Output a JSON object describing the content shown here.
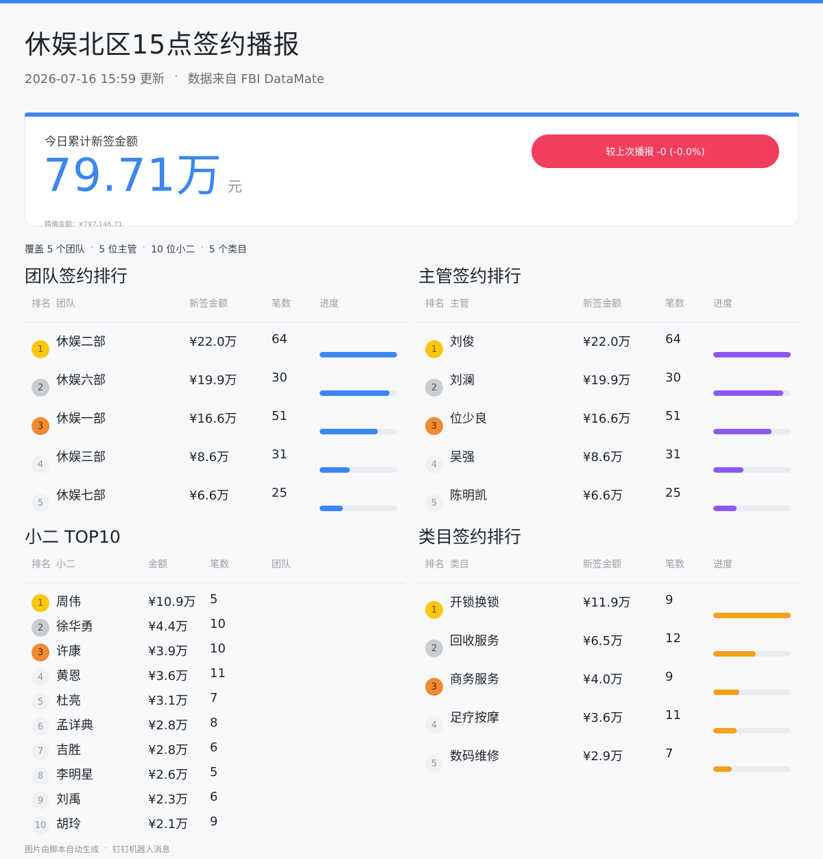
{
  "header": {
    "title": "休娱北区15点签约播报",
    "updated": "2026-07-16  15:59 更新",
    "source": "数据来自 FBI DataMate",
    "separator": "·"
  },
  "summary": {
    "label": "今日累计新签金额",
    "amount": "79.71万",
    "unit": "元",
    "exact": "精确金额：¥797,146.71",
    "compare": "较上次播报 -0 (-0.0%)"
  },
  "coverage": {
    "items": [
      "覆盖 5 个团队",
      "5 位主管",
      "10 位小二",
      "5 个类目"
    ],
    "separator": "·"
  },
  "colors": {
    "accent": "#3b86f0",
    "supervisor_bar": "#8c5af0",
    "category_bar": "#f5a01a",
    "alert": "#f23e5e"
  },
  "team_ranking": {
    "title": "团队签约排行",
    "headers": {
      "rank": "排名",
      "name": "团队",
      "amount": "新签金额",
      "count": "笔数",
      "progress": "进度"
    },
    "rows": [
      {
        "rank": "1",
        "name": "休娱二部",
        "amount": "¥22.0万",
        "count": "64",
        "progress": 1.0
      },
      {
        "rank": "2",
        "name": "休娱六部",
        "amount": "¥19.9万",
        "count": "30",
        "progress": 0.9
      },
      {
        "rank": "3",
        "name": "休娱一部",
        "amount": "¥16.6万",
        "count": "51",
        "progress": 0.75
      },
      {
        "rank": "4",
        "name": "休娱三部",
        "amount": "¥8.6万",
        "count": "31",
        "progress": 0.39
      },
      {
        "rank": "5",
        "name": "休娱七部",
        "amount": "¥6.6万",
        "count": "25",
        "progress": 0.3
      }
    ]
  },
  "supervisor_ranking": {
    "title": "主管签约排行",
    "headers": {
      "rank": "排名",
      "name": "主管",
      "amount": "新签金额",
      "count": "笔数",
      "progress": "进度"
    },
    "rows": [
      {
        "rank": "1",
        "name": "刘俊",
        "amount": "¥22.0万",
        "count": "64",
        "progress": 1.0
      },
      {
        "rank": "2",
        "name": "刘澜",
        "amount": "¥19.9万",
        "count": "30",
        "progress": 0.9
      },
      {
        "rank": "3",
        "name": "位少良",
        "amount": "¥16.6万",
        "count": "51",
        "progress": 0.75
      },
      {
        "rank": "4",
        "name": "吴强",
        "amount": "¥8.6万",
        "count": "31",
        "progress": 0.39
      },
      {
        "rank": "5",
        "name": "陈明凯",
        "amount": "¥6.6万",
        "count": "25",
        "progress": 0.3
      }
    ]
  },
  "top10": {
    "title": "小二 TOP10",
    "headers": {
      "rank": "排名",
      "name": "小二",
      "amount": "金额",
      "count": "笔数",
      "team": "团队"
    },
    "rows": [
      {
        "rank": "1",
        "name": "周伟",
        "amount": "¥10.9万",
        "count": "5"
      },
      {
        "rank": "2",
        "name": "徐华勇",
        "amount": "¥4.4万",
        "count": "10"
      },
      {
        "rank": "3",
        "name": "许康",
        "amount": "¥3.9万",
        "count": "10"
      },
      {
        "rank": "4",
        "name": "黄恩",
        "amount": "¥3.6万",
        "count": "11"
      },
      {
        "rank": "5",
        "name": "杜亮",
        "amount": "¥3.1万",
        "count": "7"
      },
      {
        "rank": "6",
        "name": "孟详典",
        "amount": "¥2.8万",
        "count": "8"
      },
      {
        "rank": "7",
        "name": "吉胜",
        "amount": "¥2.8万",
        "count": "6"
      },
      {
        "rank": "8",
        "name": "李明星",
        "amount": "¥2.6万",
        "count": "5"
      },
      {
        "rank": "9",
        "name": "刘禹",
        "amount": "¥2.3万",
        "count": "6"
      },
      {
        "rank": "10",
        "name": "胡玲",
        "amount": "¥2.1万",
        "count": "9"
      }
    ]
  },
  "category_ranking": {
    "title": "类目签约排行",
    "headers": {
      "rank": "排名",
      "name": "类目",
      "amount": "新签金额",
      "count": "笔数",
      "progress": "进度"
    },
    "rows": [
      {
        "rank": "1",
        "name": "开锁换锁",
        "amount": "¥11.9万",
        "count": "9",
        "progress": 1.0
      },
      {
        "rank": "2",
        "name": "回收服务",
        "amount": "¥6.5万",
        "count": "12",
        "progress": 0.55
      },
      {
        "rank": "3",
        "name": "商务服务",
        "amount": "¥4.0万",
        "count": "9",
        "progress": 0.34
      },
      {
        "rank": "4",
        "name": "足疗按摩",
        "amount": "¥3.6万",
        "count": "11",
        "progress": 0.3
      },
      {
        "rank": "5",
        "name": "数码维修",
        "amount": "¥2.9万",
        "count": "7",
        "progress": 0.24
      }
    ]
  },
  "footer": {
    "items": [
      "图片由脚本自动生成",
      "钉钉机器人消息"
    ],
    "separator": "·"
  }
}
